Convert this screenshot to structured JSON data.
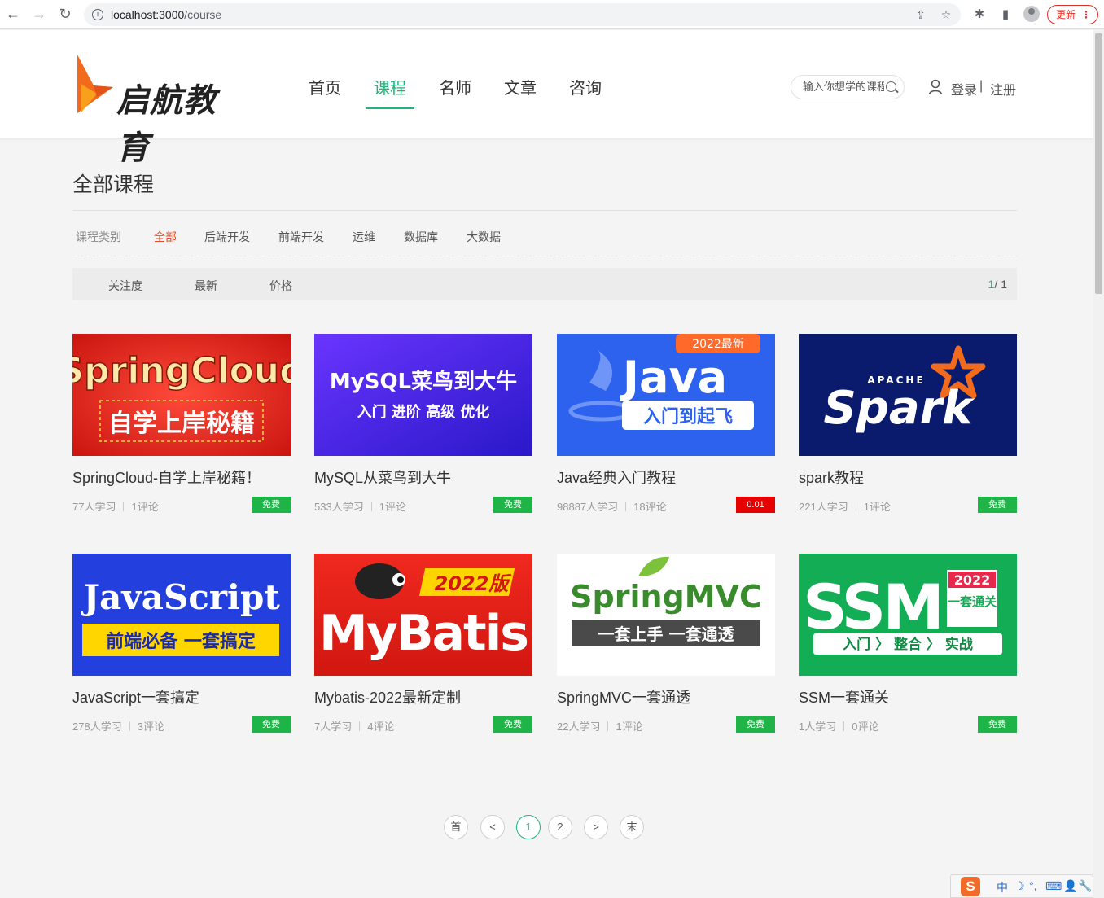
{
  "browser": {
    "url_host": "localhost:3000",
    "url_path": "/course",
    "update_label": "更新"
  },
  "header": {
    "brand": "启航教育",
    "nav": [
      "首页",
      "课程",
      "名师",
      "文章",
      "咨询"
    ],
    "active_nav": "课程",
    "search_placeholder": "输入你想学的课程",
    "login": "登录",
    "separator": "|",
    "register": "注册"
  },
  "page": {
    "title": "全部课程",
    "category_label": "课程类别",
    "categories": [
      "全部",
      "后端开发",
      "前端开发",
      "运维",
      "数据库",
      "大数据"
    ],
    "active_category": "全部",
    "sorts": [
      "关注度",
      "最新",
      "价格"
    ],
    "page_current": "1",
    "page_total": "/ 1"
  },
  "courses": [
    {
      "title": "SpringCloud-自学上岸秘籍！",
      "learners": "77人学习",
      "comments": "1评论",
      "price": "免费",
      "cover": {
        "main": "SpringCloud",
        "sub": "自学上岸秘籍",
        "colors": [
          "#e8372c",
          "#c21a14"
        ]
      }
    },
    {
      "title": "MySQL从菜鸟到大牛",
      "learners": "533人学习",
      "comments": "1评论",
      "price": "免费",
      "cover": {
        "main": "MySQL菜鸟到大牛",
        "sub": "入门 进阶 高级 优化",
        "colors": [
          "#5a2ff0",
          "#2b1ab8"
        ]
      }
    },
    {
      "title": "Java经典入门教程",
      "learners": "98887人学习",
      "comments": "18评论",
      "price": "0.01",
      "cover": {
        "main": "Java",
        "sub": "入门到起飞",
        "badge": "2022最新",
        "colors": [
          "#2f6bf2",
          "#1f4fd8"
        ]
      }
    },
    {
      "title": "spark教程",
      "learners": "221人学习",
      "comments": "1评论",
      "price": "免费",
      "cover": {
        "main": "Spark",
        "small": "APACHE",
        "colors": [
          "#0c1f7a",
          "#061357"
        ]
      }
    },
    {
      "title": "JavaScript一套搞定",
      "learners": "278人学习",
      "comments": "3评论",
      "price": "免费",
      "cover": {
        "main": "JavaScript",
        "sub": "前端必备 一套搞定",
        "colors": [
          "#2a46e0",
          "#1b2fb8"
        ]
      }
    },
    {
      "title": "Mybatis-2022最新定制",
      "learners": "7人学习",
      "comments": "4评论",
      "price": "免费",
      "cover": {
        "main": "MyBatis",
        "badge": "2022版",
        "colors": [
          "#e8231f",
          "#c4130f"
        ]
      }
    },
    {
      "title": "SpringMVC一套通透",
      "learners": "22人学习",
      "comments": "1评论",
      "price": "免费",
      "cover": {
        "main": "SpringMVC",
        "sub": "一套上手 一套通透",
        "colors": [
          "#ffffff",
          "#f6f6f6"
        ]
      }
    },
    {
      "title": "SSM一套通关",
      "learners": "1人学习",
      "comments": "0评论",
      "price": "免费",
      "cover": {
        "main": "SSM",
        "badge": "2022",
        "badge2": "一套通关",
        "sub": "入门 〉 整合 〉 实战",
        "colors": [
          "#16b35a",
          "#0e9a4a"
        ]
      }
    }
  ],
  "pagination": [
    "首",
    "<",
    "1",
    "2",
    ">",
    "末"
  ],
  "pagination_active": "1",
  "ime": {
    "items": [
      "中",
      "☽",
      "°,",
      "⌨",
      "👤",
      "🔧"
    ]
  },
  "colors": {
    "accent": "#1fb47a",
    "category_active": "#e94b2e",
    "free": "#1fb447",
    "paid": "#e60000"
  }
}
